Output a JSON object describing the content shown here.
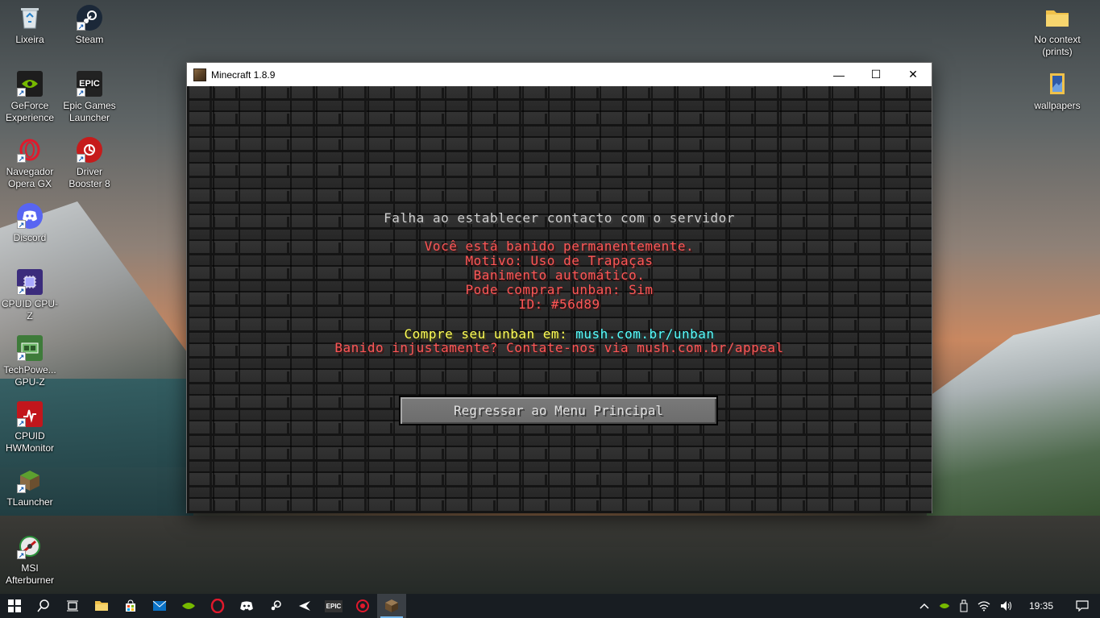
{
  "desktop": {
    "icons_left": [
      {
        "label": "Lixeira",
        "icon": "recycle-bin-icon"
      },
      {
        "label": "Steam",
        "icon": "steam-icon"
      },
      {
        "label": "GeForce Experience",
        "icon": "geforce-icon"
      },
      {
        "label": "Epic Games Launcher",
        "icon": "epic-icon"
      },
      {
        "label": "Navegador Opera GX",
        "icon": "opera-gx-icon"
      },
      {
        "label": "Driver Booster 8",
        "icon": "driver-booster-icon"
      },
      {
        "label": "Discord",
        "icon": "discord-icon"
      },
      {
        "label": "CPUID CPU-Z",
        "icon": "cpuz-icon"
      },
      {
        "label": "TechPowe... GPU-Z",
        "icon": "gpuz-icon"
      },
      {
        "label": "CPUID HWMonitor",
        "icon": "hwmonitor-icon"
      },
      {
        "label": "TLauncher",
        "icon": "tlauncher-icon"
      },
      {
        "label": "MSI Afterburner",
        "icon": "afterburner-icon"
      }
    ],
    "icons_right": [
      {
        "label": "No context (prints)",
        "icon": "folder-icon"
      },
      {
        "label": "wallpapers",
        "icon": "folder-icon"
      }
    ],
    "epic_badge": "EPIC"
  },
  "window": {
    "title": "Minecraft 1.8.9",
    "minimize": "—",
    "maximize": "☐",
    "close": "✕"
  },
  "game": {
    "heading": "Falha ao establecer contacto com o servidor",
    "ban_lines": [
      "Você está banido permanentemente.",
      "Motivo: Uso de Trapaças",
      "Banimento automático.",
      "Pode comprar unban: Sim",
      "ID: #56d89"
    ],
    "buy_prefix": "Compre seu unban em: ",
    "buy_link": "mush.com.br/unban",
    "appeal": "Banido injustamente? Contate-nos via mush.com.br/appeal",
    "button": "Regressar ao Menu Principal"
  },
  "taskbar": {
    "start": "start-icon",
    "time": "19:35",
    "epic_label": "EPIC"
  },
  "colors": {
    "mc_red": "#ff5555",
    "mc_yellow": "#ffff55",
    "mc_aqua": "#55ffff",
    "taskbar_bg": "#181d22"
  }
}
